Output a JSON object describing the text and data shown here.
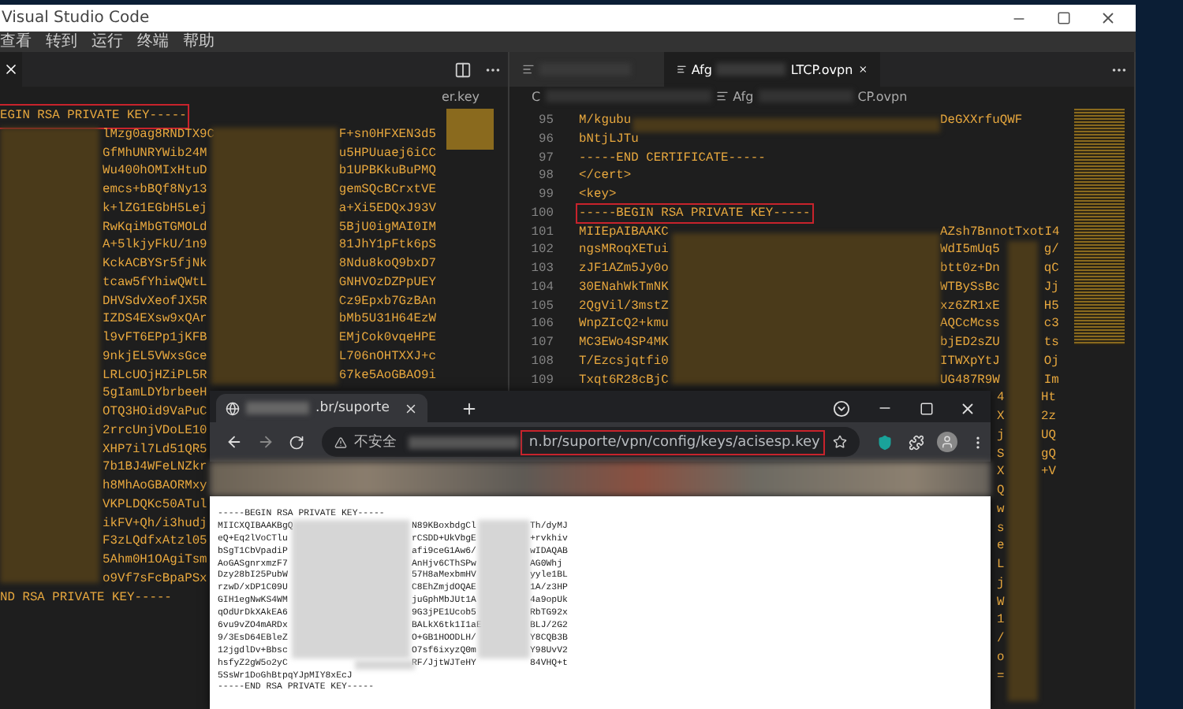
{
  "window": {
    "title": "Visual Studio Code"
  },
  "menu": [
    "查看",
    "转到",
    "运行",
    "终端",
    "帮助"
  ],
  "left_editor": {
    "breadcrumb": "er.key",
    "lines": [
      {
        "kind": "full",
        "text": "EGIN RSA PRIVATE KEY-----",
        "highlighted": true
      },
      {
        "kind": "split",
        "a": "lMzg0ag8RNDTX9C",
        "b": "F+sn0HFXEN3d5"
      },
      {
        "kind": "split",
        "a": "GfMhUNRYWib24M",
        "b": "u5HPUuaej6iCC"
      },
      {
        "kind": "split",
        "a": "Wu400hOMIxHtuD",
        "b": "b1UPBKkuBuPMQ"
      },
      {
        "kind": "split",
        "a": "emcs+bBQf8Ny13",
        "b": "gemSQcBCrxtVE"
      },
      {
        "kind": "split",
        "a": "k+lZG1EGbH5Lej",
        "b": "a+Xi5EDQxJ93V"
      },
      {
        "kind": "split",
        "a": "RwKqiMbGTGMOLd",
        "b": "5BjU0igMAI0IM"
      },
      {
        "kind": "split",
        "a": "A+5lkjyFkU/1n9",
        "b": "81JhY1pFtk6pS"
      },
      {
        "kind": "split",
        "a": "KckACBYSr5fjNk",
        "b": "8Ndu8koQ9bxD7"
      },
      {
        "kind": "split",
        "a": "tcaw5fYhiwQWtL",
        "b": "GNHVOzDZPpUEY"
      },
      {
        "kind": "split",
        "a": "DHVSdvXeofJX5R",
        "b": "Cz9Epxb7GzBAn"
      },
      {
        "kind": "split",
        "a": "IZDS4EXsw9xQAr",
        "b": "bMb5U31H64EzW"
      },
      {
        "kind": "split",
        "a": "l9vFT6EPp1jKFB",
        "b": "EMjCok0vqeHPE"
      },
      {
        "kind": "split",
        "a": "9nkjEL5VWxsGce",
        "b": "L706nOHTXXJ+c"
      },
      {
        "kind": "split",
        "a": "LRLcUOjHZiPL5R",
        "b": "67ke5AoGBAO9i"
      },
      {
        "kind": "split",
        "a": "5gIamLDYbrbeeH"
      },
      {
        "kind": "split",
        "a": "OTQ3HOid9VaPuC"
      },
      {
        "kind": "split",
        "a": "2rrcUnjVDoLE10"
      },
      {
        "kind": "split",
        "a": "XHP7il7Ld51QR5"
      },
      {
        "kind": "split",
        "a": "7b1BJ4WFeLNZkr"
      },
      {
        "kind": "split",
        "a": "h8MhAoGBAORMxy"
      },
      {
        "kind": "split",
        "a": "VKPLDQKc50ATul"
      },
      {
        "kind": "split",
        "a": "ikFV+Qh/i3hudj"
      },
      {
        "kind": "split",
        "a": "F3zLQdfxAtzl05"
      },
      {
        "kind": "split",
        "a": "5Ahm0H1OAgiTsm"
      },
      {
        "kind": "split",
        "a": "o9Vf7sFcBpaPSx"
      },
      {
        "kind": "full",
        "text": "ND RSA PRIVATE KEY-----"
      }
    ]
  },
  "right_editor": {
    "tabs": [
      {
        "selected": false
      },
      {
        "label_start": "Afg",
        "label_end": "LTCP.ovpn",
        "selected": true
      }
    ],
    "breadcrumb": {
      "folder": "C",
      "file_start": "Afg",
      "file_end": "CP.ovpn"
    },
    "lines": [
      {
        "number": "95",
        "a": "M/kgubu",
        "b": "DeGXXrfuQWF"
      },
      {
        "number": "96",
        "a": "bNtjLJTu"
      },
      {
        "number": "97",
        "a": "-----END CERTIFICATE-----"
      },
      {
        "number": "98",
        "a": "</cert>"
      },
      {
        "number": "99",
        "a": "<key>"
      },
      {
        "number": "100",
        "a": "-----BEGIN RSA PRIVATE KEY-----",
        "highlighted": true
      },
      {
        "number": "101",
        "a": "MIIEpAIBAAKC",
        "b": "AZsh7BnnotTxotI4"
      },
      {
        "number": "102",
        "a": "ngsMRoqXETui",
        "b": "WdI5mUq5",
        "c": "g/"
      },
      {
        "number": "103",
        "a": "zJF1AZm5Jy0o",
        "b": "btt0z+Dn",
        "c": "qC"
      },
      {
        "number": "104",
        "a": "30ENahWkTmNK",
        "b": "WTBySsBc",
        "c": "Jj"
      },
      {
        "number": "105",
        "a": "2QgVil/3mstZ",
        "b": "xz6ZR1xE",
        "c": "H5"
      },
      {
        "number": "106",
        "a": "WnpZIcQ2+kmu",
        "b": "AQCcMcss",
        "c": "c3"
      },
      {
        "number": "107",
        "a": "MC3EWo4SP4MK",
        "b": "bjED2sZU",
        "c": "ts"
      },
      {
        "number": "108",
        "a": "T/Ezcsjqtfi0",
        "b": "ITWXpYtJ",
        "c": "Oj"
      },
      {
        "number": "109",
        "a": "Txqt6R28cBjC",
        "b": "UG487R9W",
        "c": "Im"
      },
      {
        "d": "4",
        "c": "Ht"
      },
      {
        "d": "X",
        "c": "2z"
      },
      {
        "d": "j",
        "c": "UQ"
      },
      {
        "d": "S",
        "c": "gQ"
      },
      {
        "d": "X",
        "c": "+V"
      },
      {
        "d": "Q"
      },
      {
        "d": "w"
      },
      {
        "d": "s"
      },
      {
        "d": "e"
      },
      {
        "d": "L"
      },
      {
        "d": "j"
      },
      {
        "d": "W"
      },
      {
        "d": "1"
      },
      {
        "d": "/"
      },
      {
        "d": "o"
      },
      {
        "d": "="
      }
    ]
  },
  "browser": {
    "tab": {
      "title": ".br/suporte"
    },
    "address": {
      "security": "不安全",
      "url": "n.br/suporte/vpn/config/keys/acisesp.key",
      "highlighted": true
    },
    "page_lines": [
      {
        "a": "-----BEGIN RSA PRIVATE KEY-----"
      },
      {
        "a": "MIICXQIBAAKBgQ",
        "b": "N89KBoxbdgCl",
        "c": "Th/dyMJ"
      },
      {
        "a": "eQ+Eq2lVoCTlu",
        "b": "rCSDD+UkVbgE",
        "c": "+rvkhiv"
      },
      {
        "a": "bSgT1CbVpadiP",
        "b": "afi9ceG1Aw6/",
        "c": "wIDAQAB"
      },
      {
        "a": "AoGASgnrxmzF7",
        "b": "AnHjv6CThSPw",
        "c": "AG0Whj"
      },
      {
        "a": "Dzy28bI25PubW",
        "b": "57H8aMexbmHV",
        "c": "yyle1BL"
      },
      {
        "a": "rzwD/xDP1C09U",
        "b": "C8EhZmjdOQAE",
        "c": "1A/z3HP"
      },
      {
        "a": "GIH1egNwKS4WM",
        "b": "juGphMbJUt1A",
        "c": "4a9opUk"
      },
      {
        "a": "qOdUrDkXAkEA6",
        "b": "9G3jPE1Ucob5",
        "c": "RbTG92x"
      },
      {
        "a": "6vu9vZO4mARDx",
        "b": "BALkX6tk1I1aE",
        "c": "BLJ/2G2"
      },
      {
        "a": "9/3EsD64EBleZ",
        "b": "O+GB1HOODLH/",
        "c": "Y8CQB3B"
      },
      {
        "a": "12jgdlDv+Bbsc",
        "b": "O7sf6ixyzQ0m",
        "c": "Y98UvV2"
      },
      {
        "a": "hsfyZ2gW5o2yC",
        "b": "RF/JjtWJTeHY",
        "c": "84VHQ+t"
      },
      {
        "a": "5SsWr1DoGhBtpqYJpMIY8xEcJ"
      },
      {
        "a": "-----END RSA PRIVATE KEY-----"
      }
    ]
  }
}
